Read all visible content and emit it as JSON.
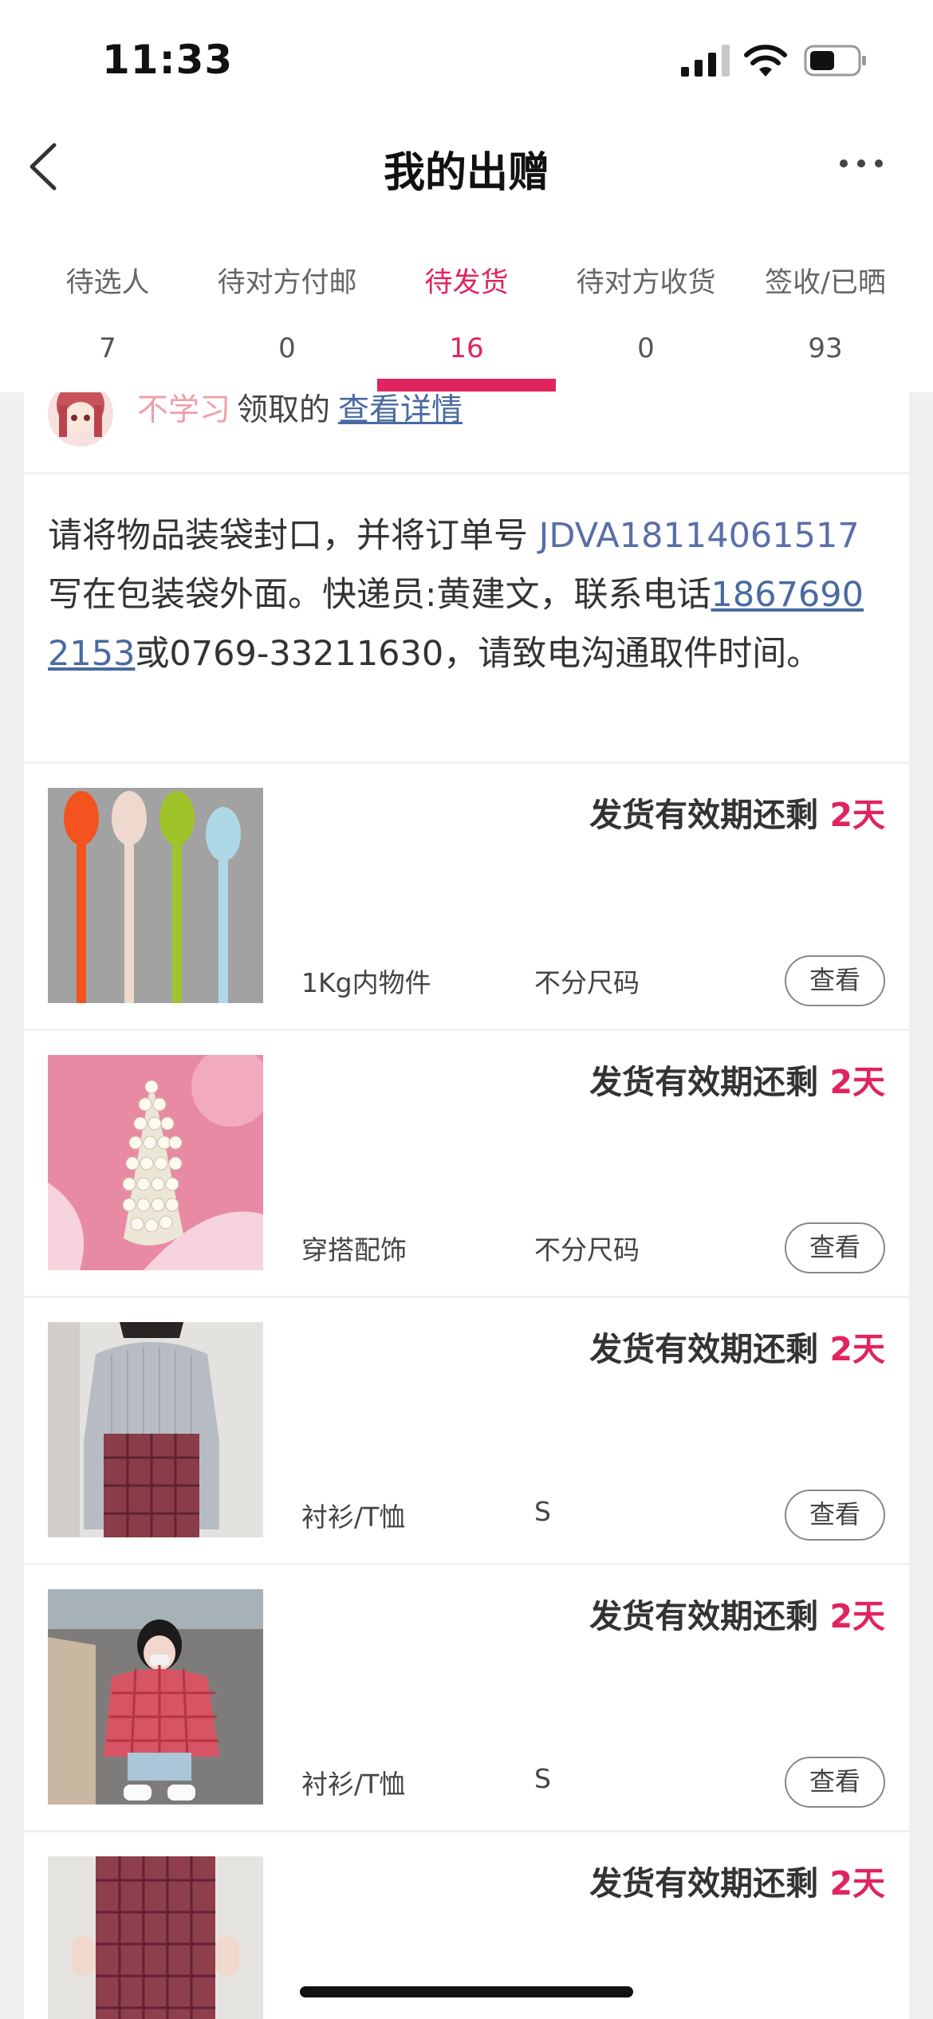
{
  "status_bar": {
    "time": "11:33"
  },
  "nav": {
    "title": "我的出赠"
  },
  "tabs": [
    {
      "label": "待选人",
      "count": "7"
    },
    {
      "label": "待对方付邮",
      "count": "0"
    },
    {
      "label": "待发货",
      "count": "16"
    },
    {
      "label": "待对方收货",
      "count": "0"
    },
    {
      "label": "签收/已晒",
      "count": "93"
    }
  ],
  "active_tab": "待发货",
  "order": {
    "user_name": "不学习",
    "claim_text": "领取的",
    "detail_link": "查看详情",
    "notice": {
      "prefix": "请将物品装袋封口，并将订单号 ",
      "order_no": "JDVA18114061517",
      "middle": " 写在包装袋外面。快递员:黄建文，联系电话",
      "phone": "18676902153",
      "suffix": "或0769-33211630，请致电沟通取件时间。"
    }
  },
  "items": [
    {
      "deadline_label": "发货有效期还剩 ",
      "days": "2天",
      "category": "1Kg内物件",
      "size": "不分尺码",
      "view_label": "查看",
      "image": "colorful-spoons"
    },
    {
      "deadline_label": "发货有效期还剩 ",
      "days": "2天",
      "category": "穿搭配饰",
      "size": "不分尺码",
      "view_label": "查看",
      "image": "pearl-hair-clip"
    },
    {
      "deadline_label": "发货有效期还剩 ",
      "days": "2天",
      "category": "衬衫/T恤",
      "size": "S",
      "view_label": "查看",
      "image": "striped-shirt-plaid-pants"
    },
    {
      "deadline_label": "发货有效期还剩 ",
      "days": "2天",
      "category": "衬衫/T恤",
      "size": "S",
      "view_label": "查看",
      "image": "red-gingham-blouse"
    },
    {
      "deadline_label": "发货有效期还剩 ",
      "days": "2天",
      "category": "",
      "size": "",
      "view_label": "",
      "image": "plaid-trousers"
    }
  ],
  "colors": {
    "accent": "#e0245e",
    "link": "#4a6aa0",
    "username": "#f0a0a8"
  }
}
